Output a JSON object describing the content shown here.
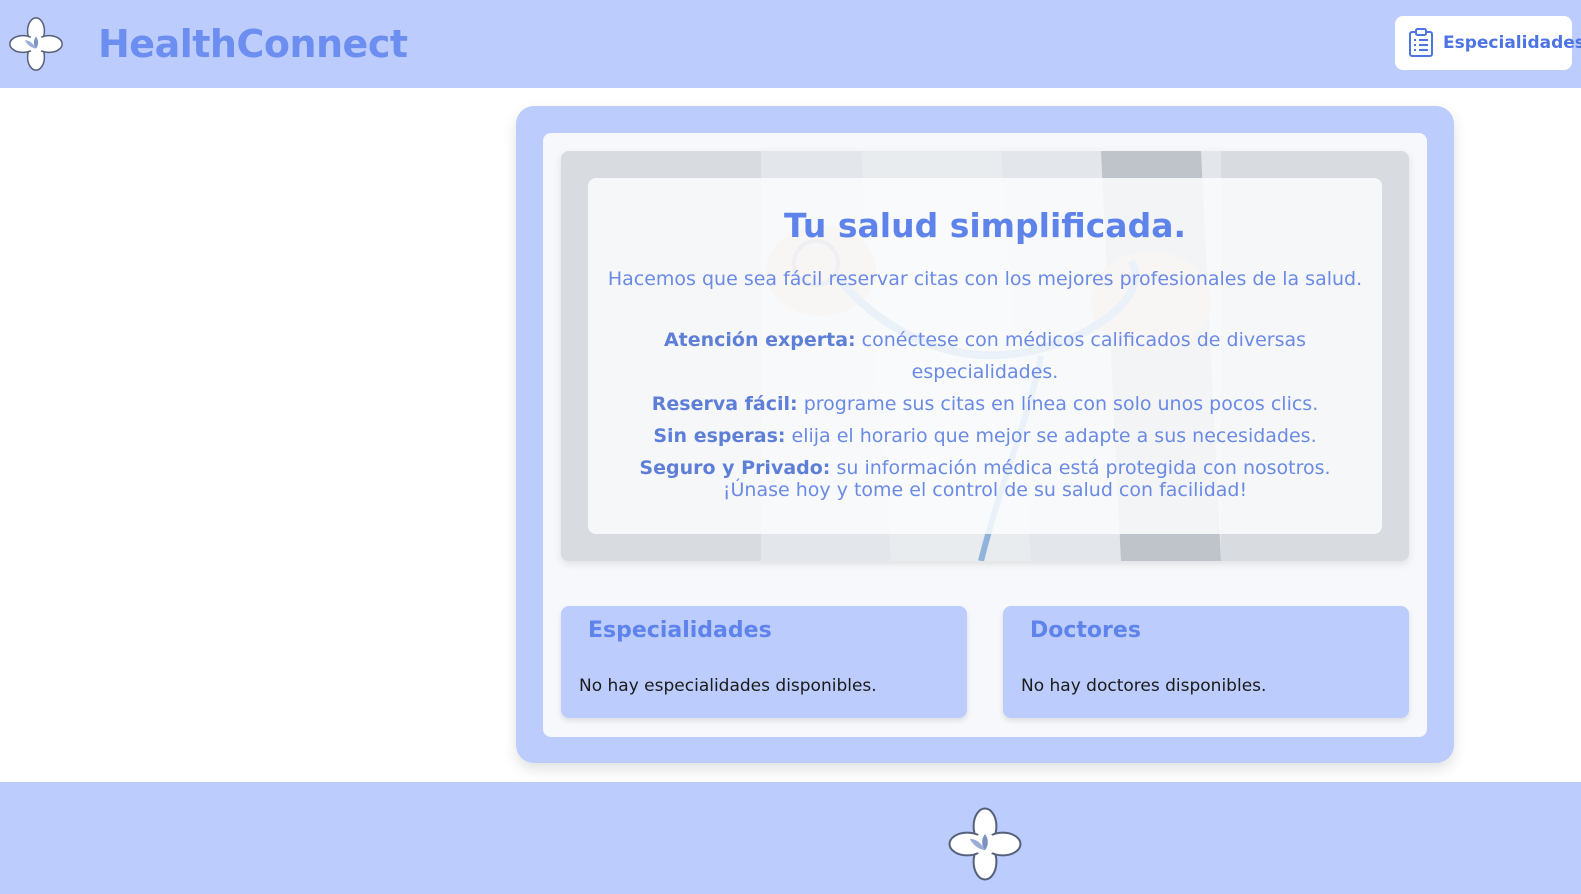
{
  "header": {
    "brand": "HealthConnect",
    "nav": {
      "label": "Especialidades",
      "icon": "clipboard-icon"
    },
    "logo_icon": "medical-cross-leaf-icon"
  },
  "hero": {
    "title": "Tu salud simplificada.",
    "intro": "Hacemos que sea fácil reservar citas con los mejores profesionales de la salud.",
    "features": [
      {
        "label": "Atención experta:",
        "text": "conéctese con médicos calificados de diversas especialidades."
      },
      {
        "label": "Reserva fácil:",
        "text": "programe sus citas en línea con solo unos pocos clics."
      },
      {
        "label": "Sin esperas:",
        "text": "elija el horario que mejor se adapte a sus necesidades."
      },
      {
        "label": "Seguro y Privado:",
        "text": "su información médica está protegida con nosotros."
      }
    ],
    "cta": "¡Únase hoy y tome el control de su salud con facilidad!"
  },
  "sections": {
    "specialties": {
      "title": "Especialidades",
      "empty": "No hay especialidades disponibles."
    },
    "doctors": {
      "title": "Doctores",
      "empty": "No hay doctores disponibles."
    }
  },
  "footer": {
    "logo_icon": "medical-cross-leaf-icon"
  },
  "colors": {
    "header_bg": "#bccdfd",
    "accent": "#5e83ea",
    "brand_text": "#6b8ef0",
    "panel_bg": "#f7f8fb"
  }
}
